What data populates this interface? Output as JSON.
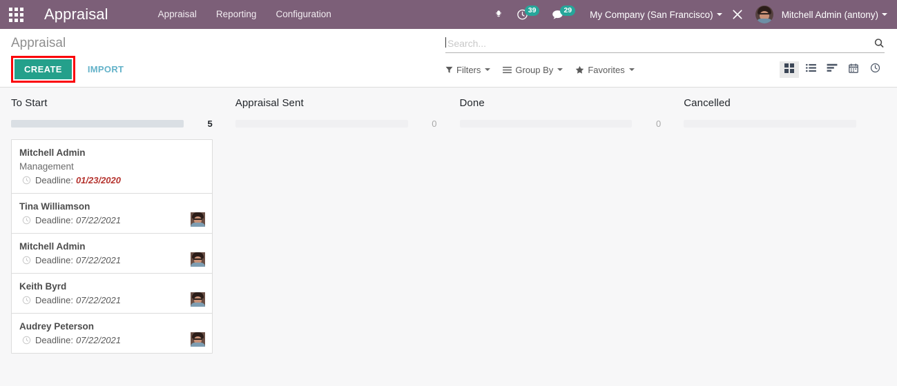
{
  "navbar": {
    "apps_icon": "apps-grid-icon",
    "brand": "Appraisal",
    "menu": [
      {
        "label": "Appraisal"
      },
      {
        "label": "Reporting"
      },
      {
        "label": "Configuration"
      }
    ],
    "bug_icon": "bug-icon",
    "activity_icon": "clock-activity-icon",
    "activity_count": "39",
    "messaging_icon": "chat-bubble-icon",
    "messaging_count": "29",
    "company": "My Company (San Francisco)",
    "debug_icon": "crossed-tools-debug-icon",
    "user": "Mitchell Admin (antony)",
    "avatar": "user-avatar",
    "accent_bg": "#7c5f78",
    "badge_color": "#26a69a"
  },
  "control_panel": {
    "breadcrumb": "Appraisal",
    "create_label": "CREATE",
    "import_label": "IMPORT",
    "create_highlight_color": "#fb0007",
    "create_bg": "#24a08b",
    "import_color": "#63b2c9",
    "search": {
      "value": "",
      "placeholder": "Search...",
      "icon": "search-icon"
    },
    "filters": [
      {
        "label": "Filters",
        "icon": "funnel-icon"
      },
      {
        "label": "Group By",
        "icon": "bars-icon"
      },
      {
        "label": "Favorites",
        "icon": "star-icon"
      }
    ],
    "views": [
      {
        "name": "kanban",
        "icon": "kanban-view-icon",
        "active": true
      },
      {
        "name": "list",
        "icon": "list-view-icon",
        "active": false
      },
      {
        "name": "pivot",
        "icon": "pivot-view-icon",
        "active": false
      },
      {
        "name": "calendar",
        "icon": "calendar-view-icon",
        "active": false
      },
      {
        "name": "activity",
        "icon": "activity-clock-view-icon",
        "active": false
      }
    ]
  },
  "kanban": {
    "columns": [
      {
        "title": "To Start",
        "count": "5",
        "bar": "filled",
        "cards": [
          {
            "name": "Mitchell Admin",
            "dept": "Management",
            "deadline_label": "Deadline:",
            "deadline": "01/23/2020",
            "overdue": true,
            "avatar": false
          },
          {
            "name": "Tina Williamson",
            "dept": "",
            "deadline_label": "Deadline:",
            "deadline": "07/22/2021",
            "overdue": false,
            "avatar": true
          },
          {
            "name": "Mitchell Admin",
            "dept": "",
            "deadline_label": "Deadline:",
            "deadline": "07/22/2021",
            "overdue": false,
            "avatar": true
          },
          {
            "name": "Keith Byrd",
            "dept": "",
            "deadline_label": "Deadline:",
            "deadline": "07/22/2021",
            "overdue": false,
            "avatar": true
          },
          {
            "name": "Audrey Peterson",
            "dept": "",
            "deadline_label": "Deadline:",
            "deadline": "07/22/2021",
            "overdue": false,
            "avatar": true
          }
        ]
      },
      {
        "title": "Appraisal Sent",
        "count": "0",
        "bar": "empty",
        "cards": []
      },
      {
        "title": "Done",
        "count": "0",
        "bar": "empty",
        "cards": []
      },
      {
        "title": "Cancelled",
        "count": "",
        "bar": "empty",
        "cards": []
      }
    ]
  }
}
